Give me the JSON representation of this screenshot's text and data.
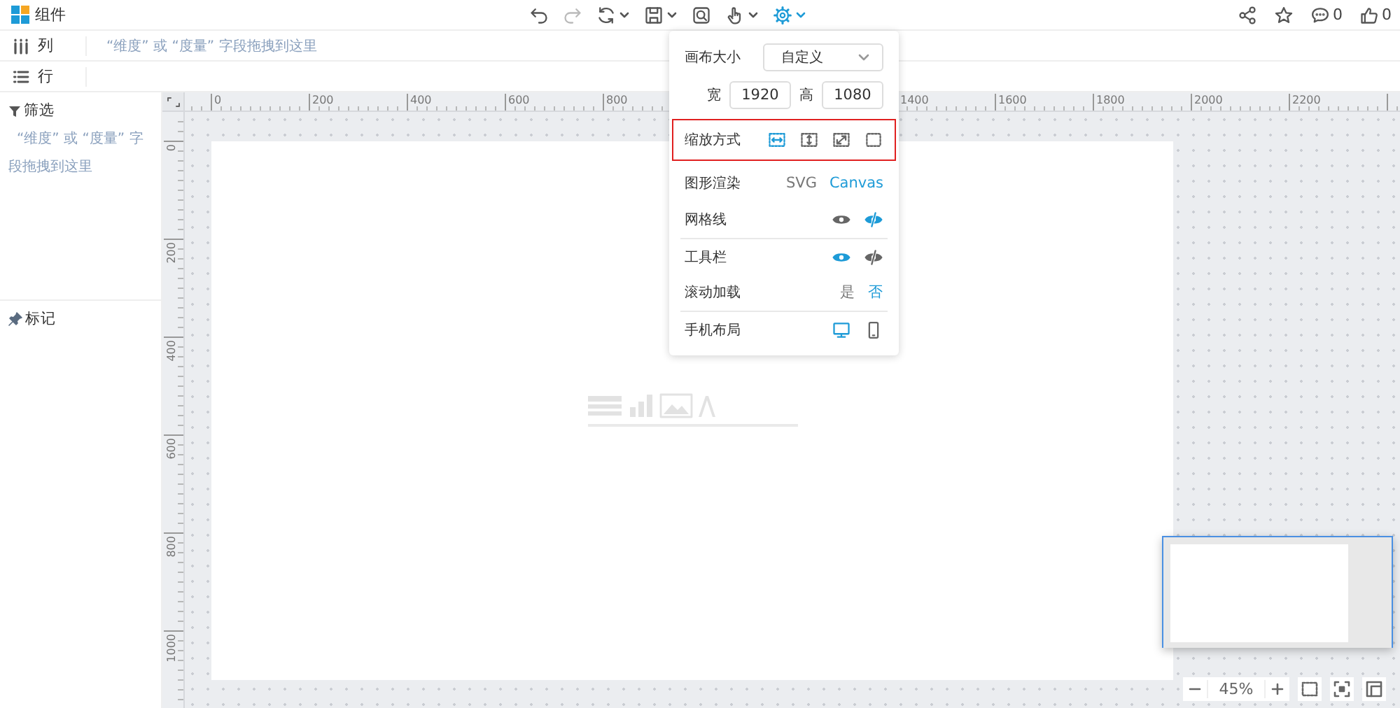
{
  "app": {
    "title": "组件"
  },
  "toolbar": [
    {
      "kind": "undo",
      "disabled": false,
      "dropdown": false,
      "active": false
    },
    {
      "kind": "redo",
      "disabled": true,
      "dropdown": false,
      "active": false
    },
    {
      "kind": "refresh",
      "disabled": false,
      "dropdown": true,
      "active": false
    },
    {
      "kind": "save",
      "disabled": false,
      "dropdown": true,
      "active": false
    },
    {
      "kind": "preview",
      "disabled": false,
      "dropdown": false,
      "active": false
    },
    {
      "kind": "hand",
      "disabled": false,
      "dropdown": true,
      "active": false
    },
    {
      "kind": "settings",
      "disabled": false,
      "dropdown": true,
      "active": true
    }
  ],
  "actions": [
    {
      "kind": "share"
    },
    {
      "kind": "star"
    },
    {
      "kind": "comment",
      "count": "0"
    },
    {
      "kind": "like",
      "count": "0"
    }
  ],
  "shelves": [
    {
      "kind": "columns",
      "label": "列",
      "placeholder": "“维度” 或 “度量” 字段拖拽到这里"
    },
    {
      "kind": "rows",
      "label": "行"
    }
  ],
  "sidebar": {
    "filter": {
      "title": "筛选",
      "hint": "“维度” 或 “度量” 字段拖拽到这里"
    },
    "marks": {
      "title": "标记"
    }
  },
  "ruler": {
    "x_labels": [
      "0",
      "200",
      "400",
      "600",
      "800",
      "1400",
      "1600",
      "1800",
      "2000",
      "2200"
    ],
    "y_labels": [
      "0",
      "200",
      "400",
      "600",
      "800",
      "1000"
    ]
  },
  "zoom": {
    "value": "45%"
  },
  "settings_popup": {
    "rows": [
      {
        "kind": "select",
        "label": "画布大小",
        "value": "自定义"
      },
      {
        "kind": "size",
        "fields": [
          {
            "label": "宽",
            "value": "1920"
          },
          {
            "label": "高",
            "value": "1080"
          }
        ]
      },
      {
        "kind": "icons",
        "label": "缩放方式",
        "highlighted": true,
        "options": [
          {
            "kind": "fit-width",
            "selected": true
          },
          {
            "kind": "fit-height",
            "selected": false
          },
          {
            "kind": "stretch",
            "selected": false
          },
          {
            "kind": "original",
            "selected": false
          }
        ]
      },
      {
        "kind": "texts",
        "label": "图形渲染",
        "options": [
          {
            "text": "SVG",
            "selected": false
          },
          {
            "text": "Canvas",
            "selected": true
          }
        ]
      },
      {
        "kind": "icons",
        "label": "网格线",
        "options": [
          {
            "kind": "show",
            "selected": false
          },
          {
            "kind": "hide",
            "selected": true
          }
        ]
      },
      {
        "kind": "icons",
        "label": "工具栏",
        "separated": true,
        "options": [
          {
            "kind": "show",
            "selected": true
          },
          {
            "kind": "hide",
            "selected": false
          }
        ]
      },
      {
        "kind": "texts",
        "label": "滚动加载",
        "options": [
          {
            "text": "是",
            "selected": false
          },
          {
            "text": "否",
            "selected": true
          }
        ]
      },
      {
        "kind": "icons",
        "label": "手机布局",
        "separated": true,
        "options": [
          {
            "kind": "desktop",
            "selected": true
          },
          {
            "kind": "mobile",
            "selected": false
          }
        ]
      }
    ]
  }
}
